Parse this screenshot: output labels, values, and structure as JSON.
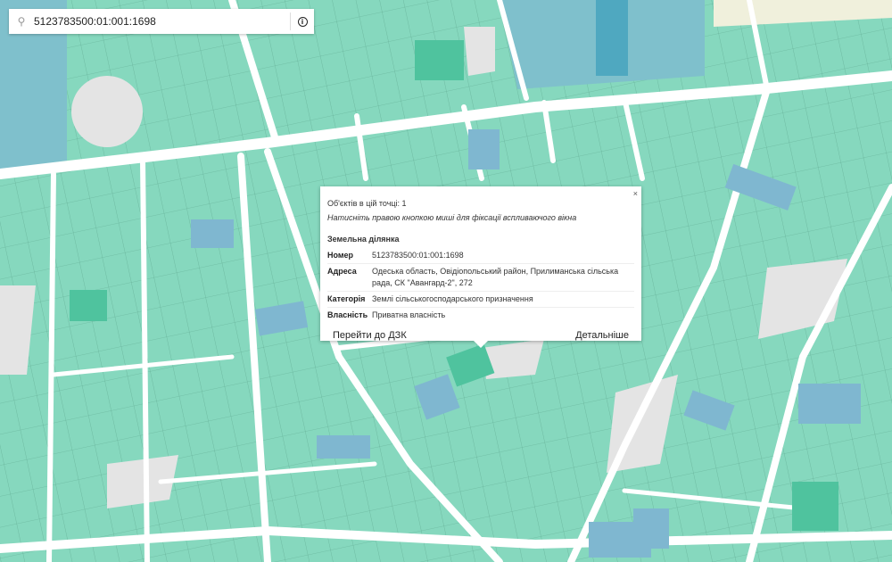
{
  "search": {
    "value": "5123783500:01:001:1698",
    "icon": "search-icon",
    "info_icon": "info-icon"
  },
  "popup": {
    "close": "×",
    "count": "Об'єктів в цій точці: 1",
    "hint": "Натисніть правою кнопкою миші для фіксації вспливаючого вікна",
    "title": "Земельна ділянка",
    "rows": [
      {
        "key": "Номер",
        "value": "5123783500:01:001:1698"
      },
      {
        "key": "Адреса",
        "value": "Одеська область, Овідіопольський район, Прилиманська сільська рада, СК \"Авангард-2\", 272"
      },
      {
        "key": "Категорія",
        "value": "Землі сільськогосподарського призначення"
      },
      {
        "key": "Власність",
        "value": "Приватна власність"
      }
    ],
    "btn_dzk": "Перейти до ДЗК",
    "btn_details": "Детальніше"
  },
  "colors": {
    "parcel": "#86d8be",
    "parcel_dark": "#4fc39e",
    "parcel_blue": "#7fb7d0",
    "water": "#7fc0cc",
    "road": "#ffffff",
    "block": "#e4e4e4"
  }
}
